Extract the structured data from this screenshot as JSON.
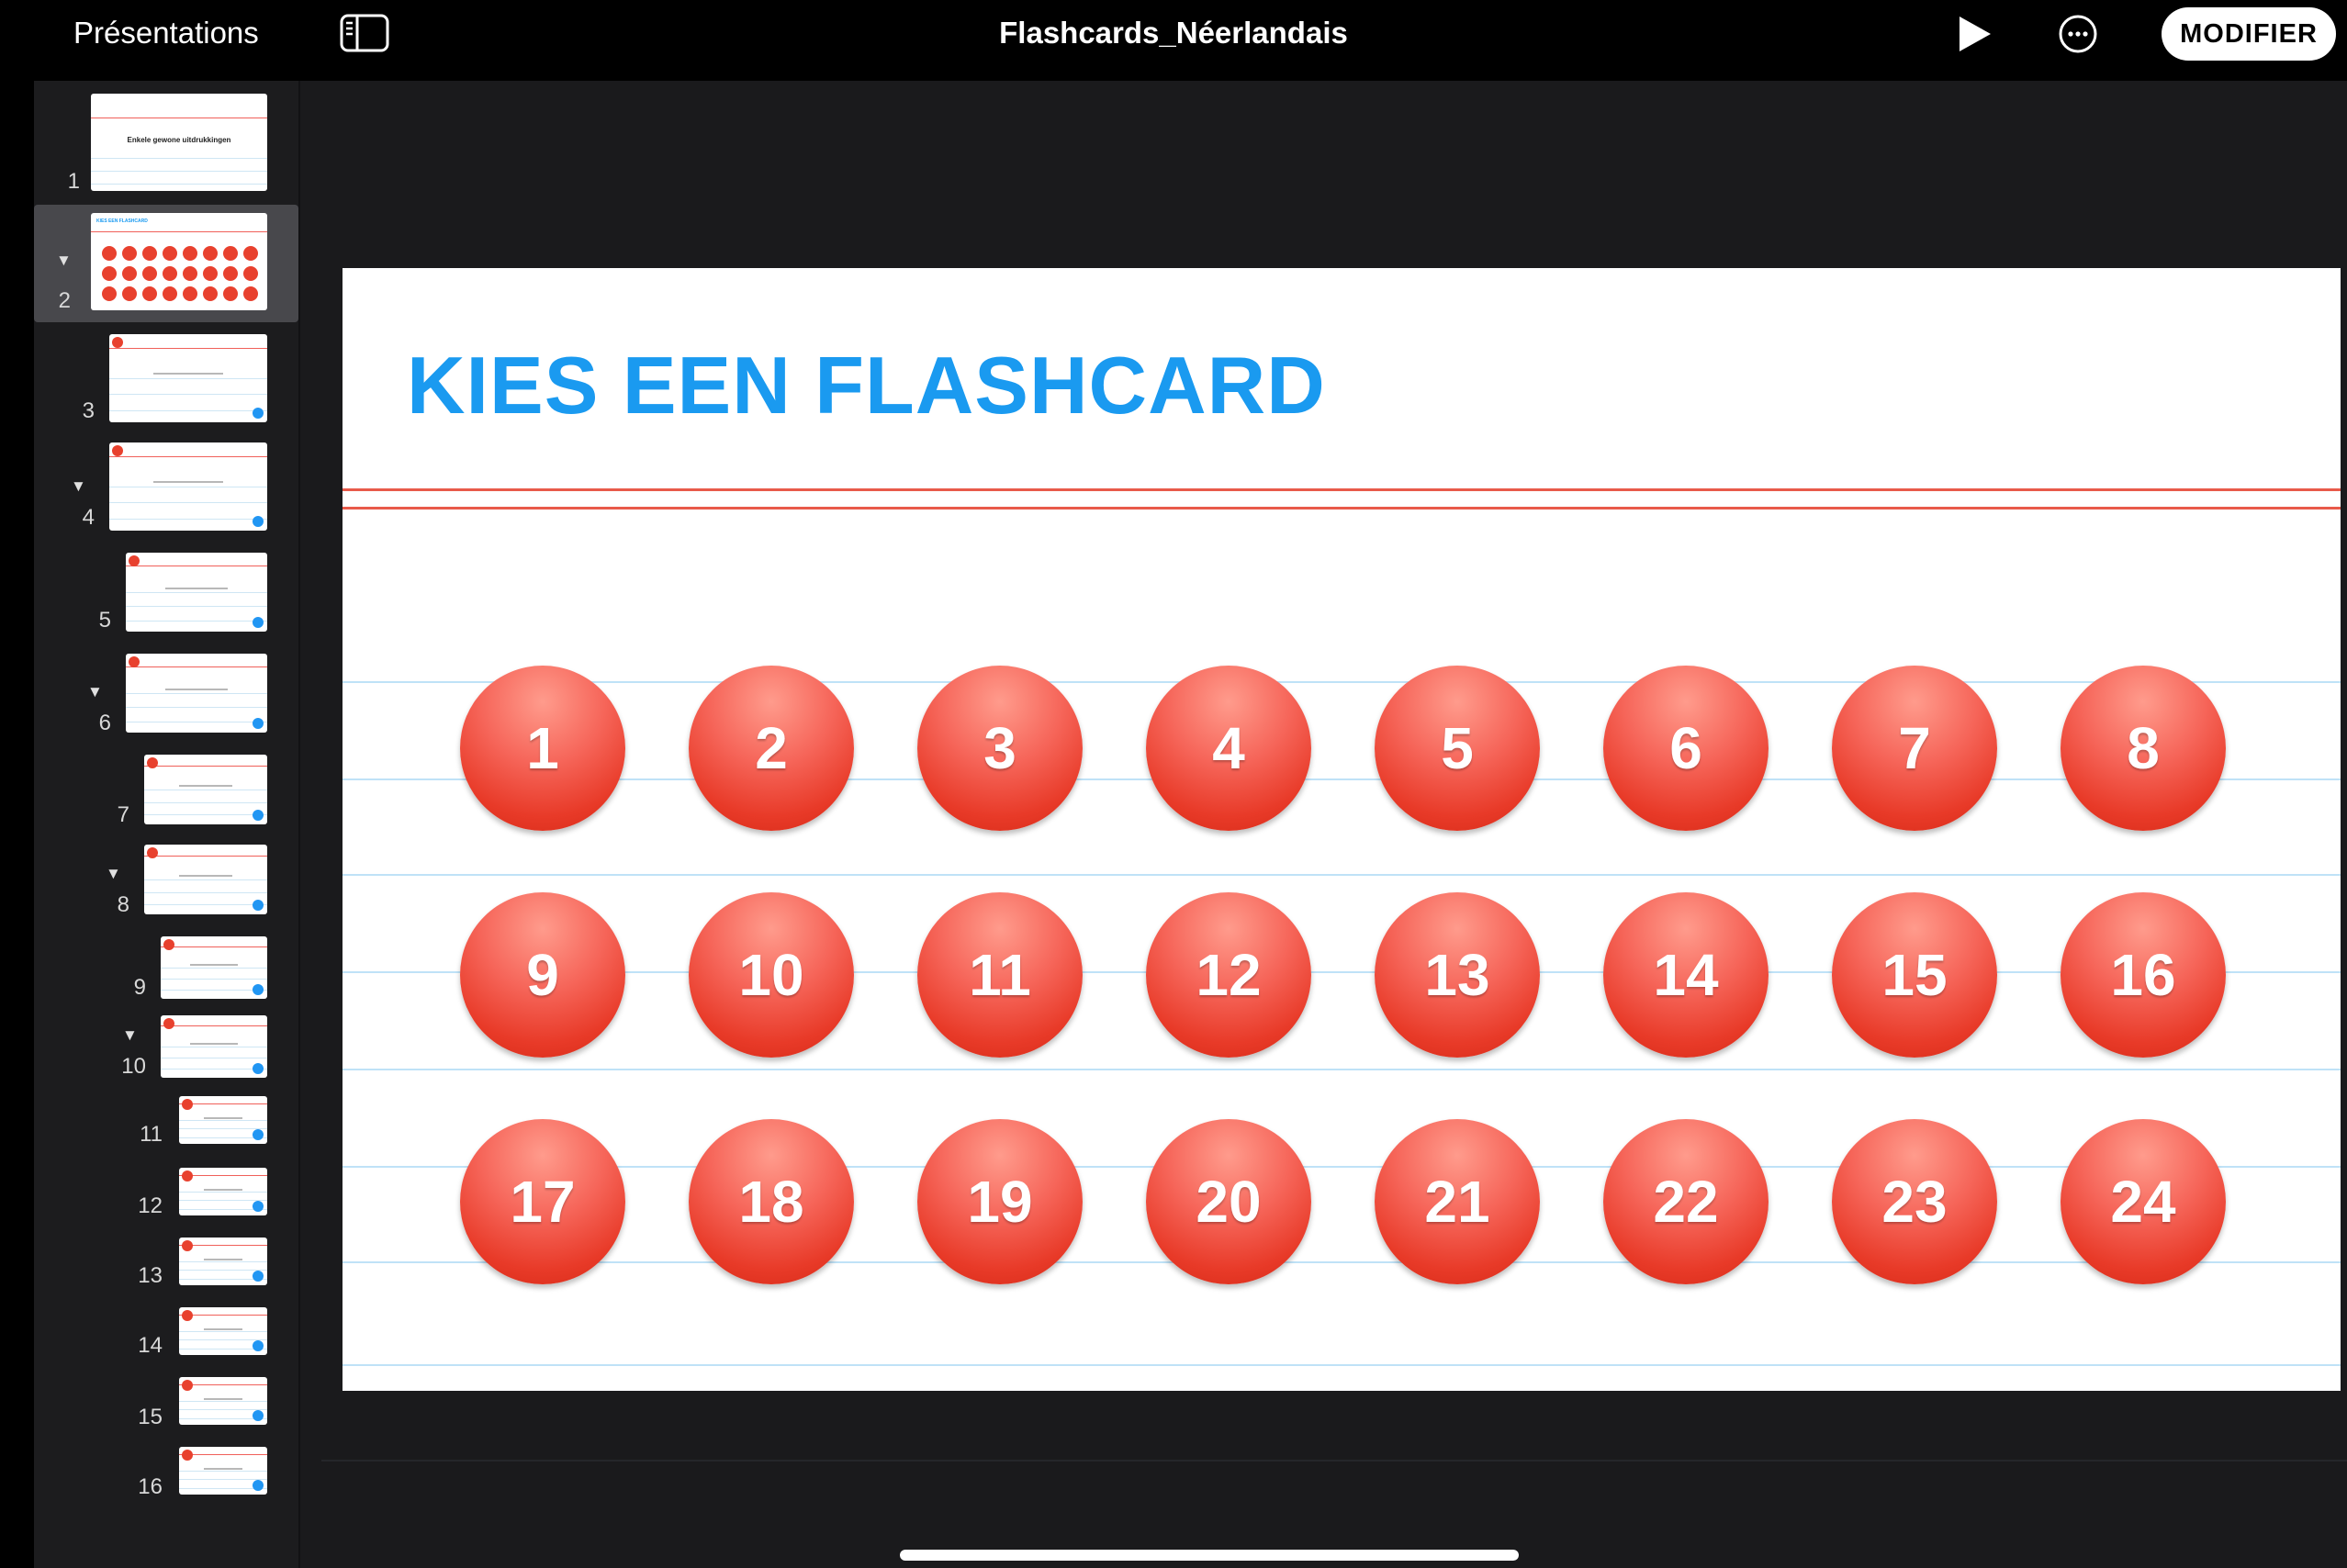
{
  "topbar": {
    "back_label": "Présentations",
    "title": "Flashcards_Néerlandais",
    "modify_label": "MODIFIER",
    "icons": [
      "sidebar-toggle-icon",
      "play-icon",
      "more-icon"
    ]
  },
  "navigator": {
    "selected_slide": 2,
    "slides": [
      {
        "number": "1",
        "title": "Enkele gewone uitdrukkingen"
      },
      {
        "number": "2",
        "title": "KIES EEN FLASHCARD"
      },
      {
        "number": "3"
      },
      {
        "number": "4"
      },
      {
        "number": "5"
      },
      {
        "number": "6"
      },
      {
        "number": "7"
      },
      {
        "number": "8"
      },
      {
        "number": "9"
      },
      {
        "number": "10"
      },
      {
        "number": "11"
      },
      {
        "number": "12"
      },
      {
        "number": "13"
      },
      {
        "number": "14"
      },
      {
        "number": "15"
      },
      {
        "number": "16"
      }
    ]
  },
  "slide": {
    "title": "KIES EEN FLASHCARD",
    "buttons": [
      "1",
      "2",
      "3",
      "4",
      "5",
      "6",
      "7",
      "8",
      "9",
      "10",
      "11",
      "12",
      "13",
      "14",
      "15",
      "16",
      "17",
      "18",
      "19",
      "20",
      "21",
      "22",
      "23",
      "24"
    ]
  },
  "colors": {
    "title_blue": "#1a9af0",
    "bubble_red": "#e83a28",
    "rule_red": "#e85a4a",
    "rule_blue": "#bfe2f7"
  }
}
